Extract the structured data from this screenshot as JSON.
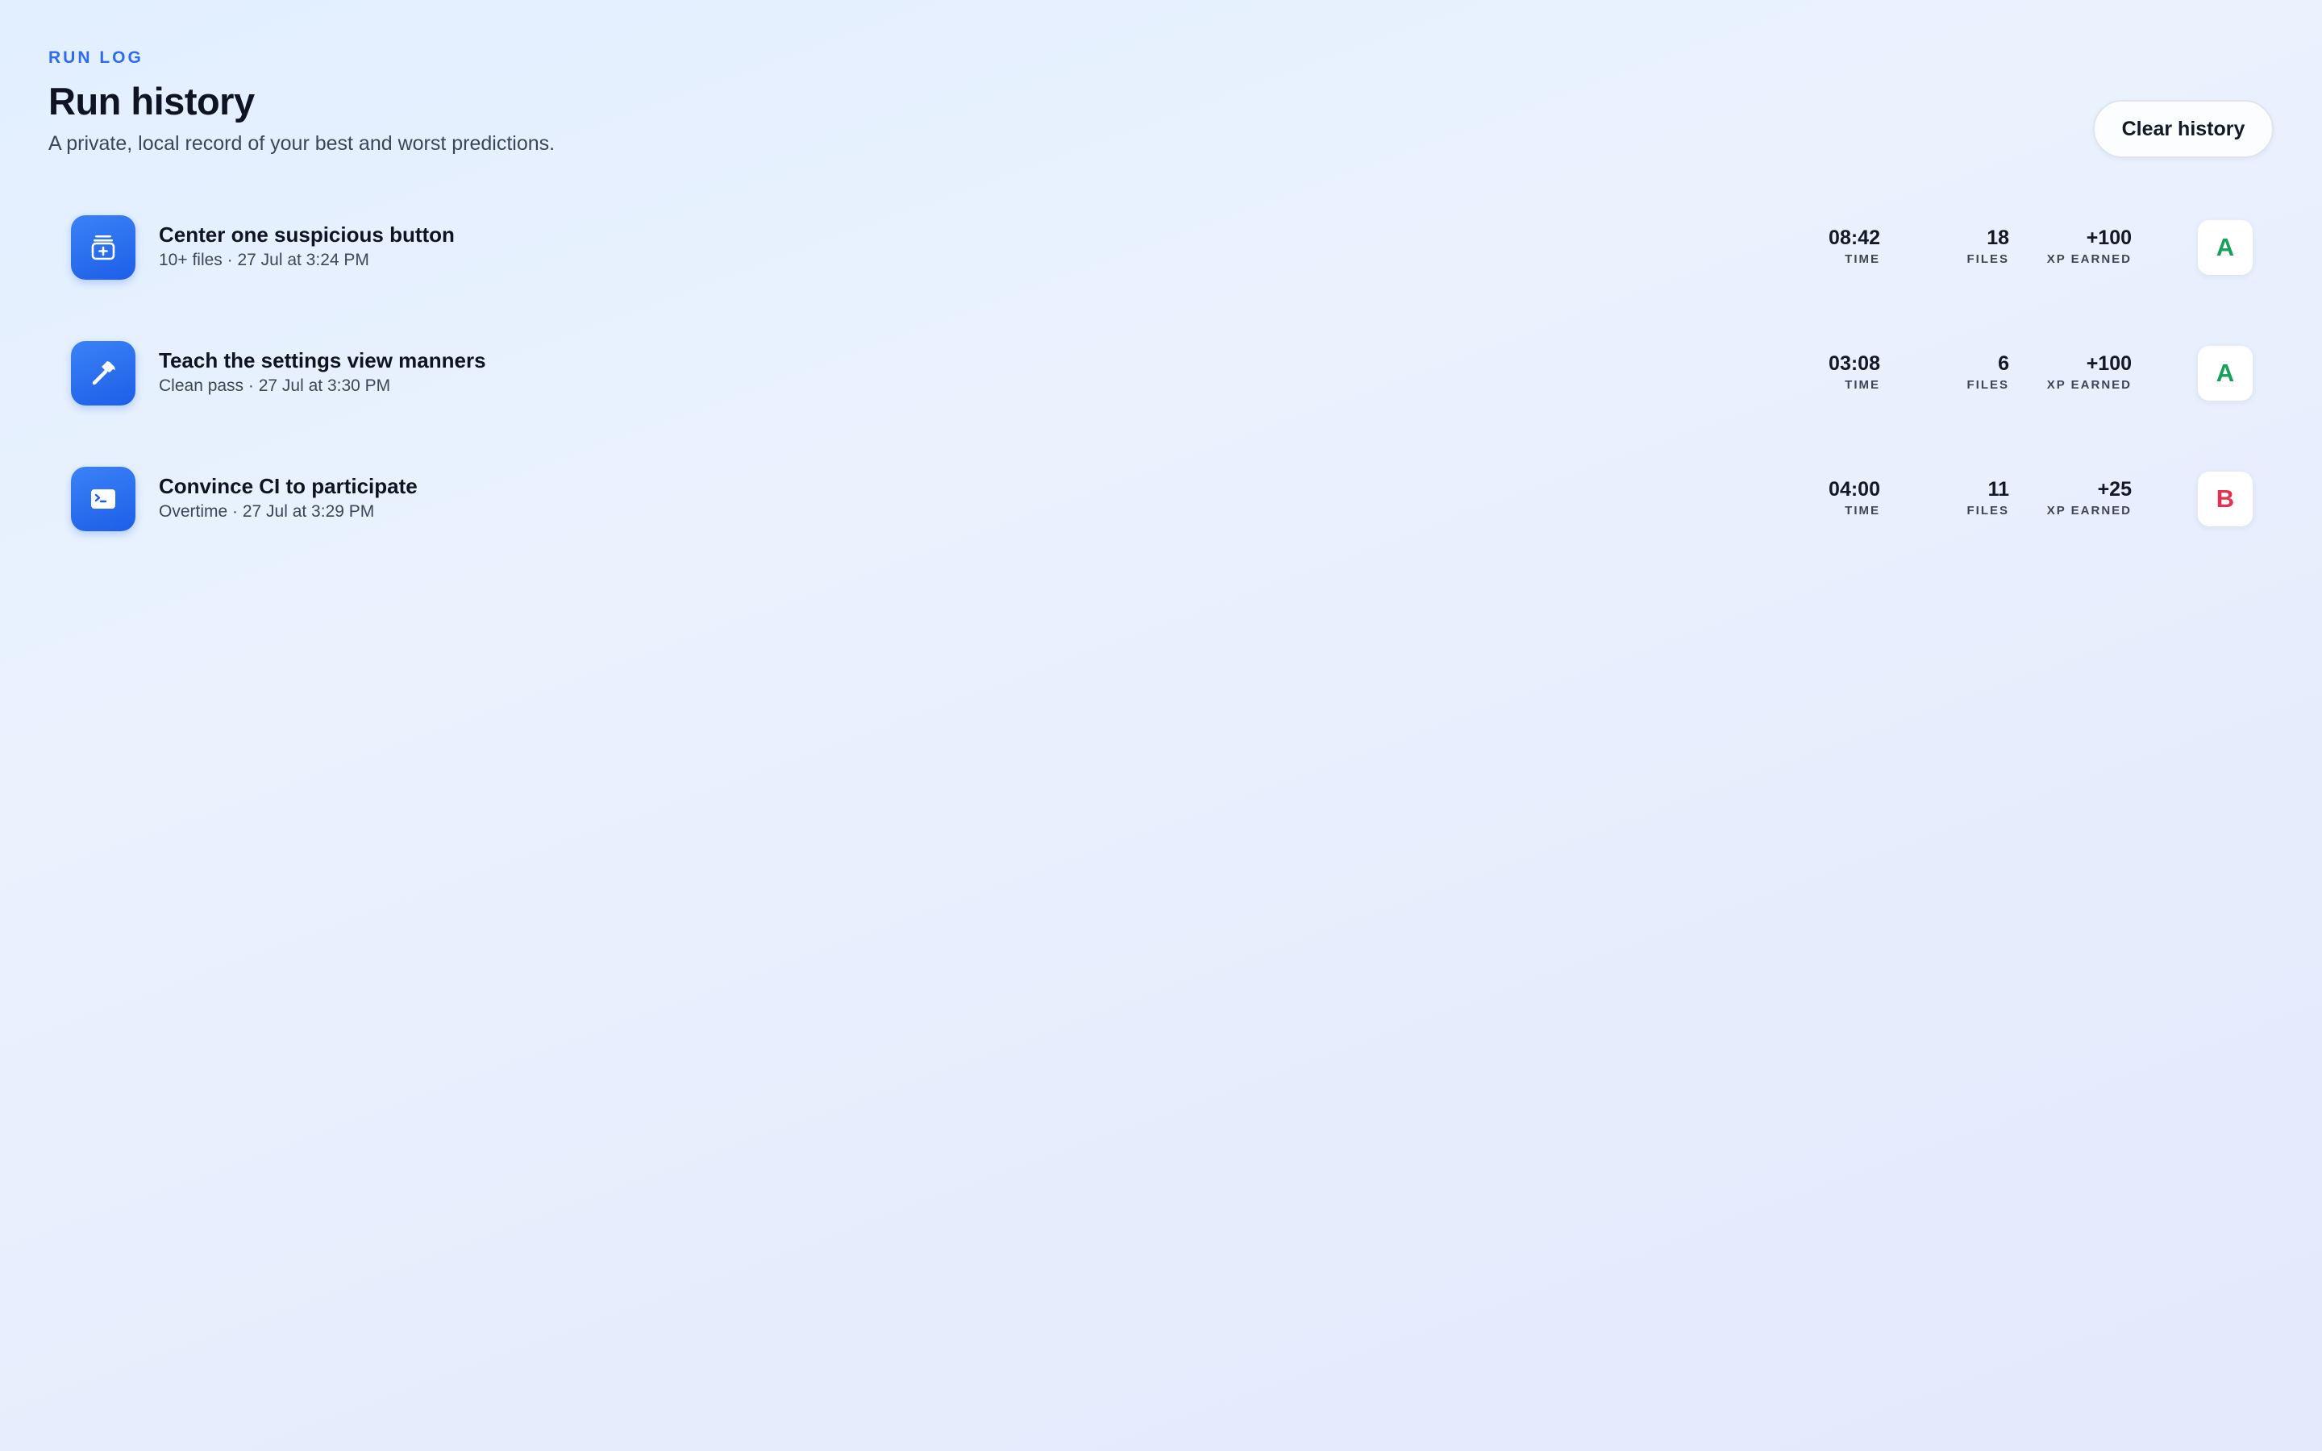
{
  "header": {
    "eyebrow": "RUN LOG",
    "title": "Run history",
    "subtitle": "A private, local record of your best and worst predictions."
  },
  "toolbar": {
    "clear_label": "Clear history"
  },
  "colors": {
    "accent": "#2f6bf0",
    "grade_a": "#16a05a",
    "grade_b": "#e5304f",
    "icon_bg": "#2563eb"
  },
  "runs": [
    {
      "icon": "package-icon",
      "title": "Center one suspicious button",
      "subtitle": "10+ files · 27 Jul at 3:24 PM",
      "time": "08:42",
      "time_label": "TIME",
      "files": "18",
      "files_label": "FILES",
      "xp": "+100",
      "xp_label": "XP EARNED",
      "grade": "A",
      "grade_color": "#16a05a"
    },
    {
      "icon": "hammer-icon",
      "title": "Teach the settings view manners",
      "subtitle": "Clean pass · 27 Jul at 3:30 PM",
      "time": "03:08",
      "time_label": "TIME",
      "files": "6",
      "files_label": "FILES",
      "xp": "+100",
      "xp_label": "XP EARNED",
      "grade": "A",
      "grade_color": "#16a05a"
    },
    {
      "icon": "terminal-icon",
      "title": "Convince CI to participate",
      "subtitle": "Overtime · 27 Jul at 3:29 PM",
      "time": "04:00",
      "time_label": "TIME",
      "files": "11",
      "files_label": "FILES",
      "xp": "+25",
      "xp_label": "XP EARNED",
      "grade": "B",
      "grade_color": "#e5304f"
    }
  ]
}
